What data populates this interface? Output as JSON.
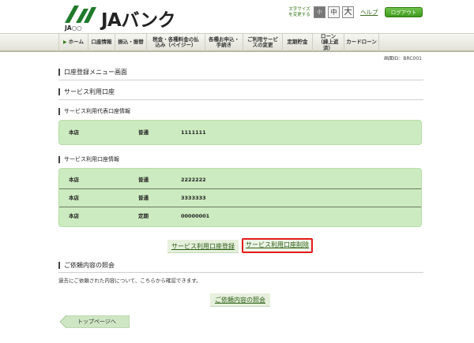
{
  "header": {
    "logo_text": "JAバンク",
    "logo_sub": "JA○○",
    "fontsize_label": "文字サイズを変更する",
    "fontsize_small": "小",
    "fontsize_mid": "中",
    "fontsize_large": "大",
    "help": "ヘルプ",
    "logout": "ログアウト"
  },
  "nav": {
    "items": [
      "ホーム",
      "口座情報",
      "振込・振替",
      "税金・各種料金の払込み（ペイジー）",
      "各種お申込・手続き",
      "ご利用サービスの変更",
      "定期貯金",
      "ローン（繰上返済）",
      "カードローン"
    ]
  },
  "screen_id": "画面ID：BRC001",
  "page_title": "口座登録メニュー画面",
  "section_service_accounts": "サービス利用口座",
  "rep_info_title": "サービス利用代表口座情報",
  "rep_account": {
    "branch": "本店",
    "type": "普通",
    "number": "1111111"
  },
  "svc_info_title": "サービス利用口座情報",
  "svc_accounts": [
    {
      "branch": "本店",
      "type": "普通",
      "number": "2222222"
    },
    {
      "branch": "本店",
      "type": "普通",
      "number": "3333333"
    },
    {
      "branch": "本店",
      "type": "定期",
      "number": "00000001"
    }
  ],
  "buttons": {
    "register": "サービス利用口座登録",
    "delete": "サービス利用口座削除",
    "inquiry": "ご依頼内容の照会",
    "top": "トップページへ"
  },
  "inquiry_title": "ご依頼内容の照会",
  "inquiry_desc": "過去にご依頼された内容について、こちらから確認できます。",
  "colors": {
    "accent": "#3e9a1e",
    "box_bg": "#ccebc0",
    "highlight": "#e51b1b"
  }
}
